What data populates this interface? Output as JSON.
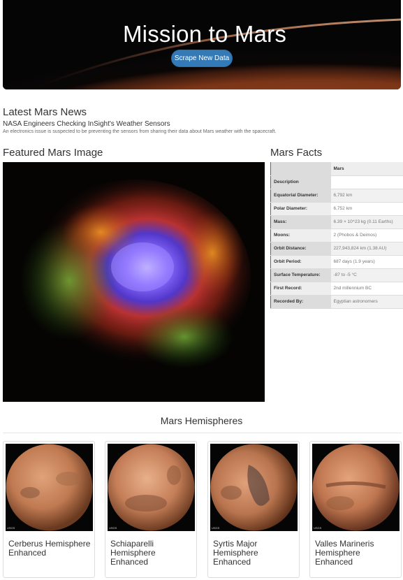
{
  "header": {
    "title": "Mission to Mars",
    "scrape_button": "Scrape New Data"
  },
  "news": {
    "heading": "Latest Mars News",
    "title": "NASA Engineers Checking InSight's Weather Sensors",
    "teaser": "An electronics issue is suspected to be preventing the sensors from sharing their data about Mars weather with the spacecraft."
  },
  "featured": {
    "heading": "Featured Mars Image"
  },
  "facts": {
    "heading": "Mars Facts",
    "column_header": "Mars",
    "index_header": "Description",
    "rows": [
      {
        "label": "Equatorial Diameter:",
        "value": "6,792 km"
      },
      {
        "label": "Polar Diameter:",
        "value": "6,752 km"
      },
      {
        "label": "Mass:",
        "value": "6.39 × 10^23 kg (0.11 Earths)"
      },
      {
        "label": "Moons:",
        "value": "2 (Phobos & Deimos)"
      },
      {
        "label": "Orbit Distance:",
        "value": "227,943,824 km (1.38 AU)"
      },
      {
        "label": "Orbit Period:",
        "value": "687 days (1.9 years)"
      },
      {
        "label": "Surface Temperature:",
        "value": "-87 to -5 °C"
      },
      {
        "label": "First Record:",
        "value": "2nd millennium BC"
      },
      {
        "label": "Recorded By:",
        "value": "Egyptian astronomers"
      }
    ]
  },
  "hemispheres": {
    "heading": "Mars Hemispheres",
    "items": [
      {
        "title": "Cerberus Hemisphere Enhanced",
        "logo": "USGS"
      },
      {
        "title": "Schiaparelli Hemisphere Enhanced",
        "logo": "USGS"
      },
      {
        "title": "Syrtis Major Hemisphere Enhanced",
        "logo": "USGS"
      },
      {
        "title": "Valles Marineris Hemisphere Enhanced",
        "logo": "USGS"
      }
    ]
  },
  "colors": {
    "button": "#337ab7",
    "text": "#333333",
    "mars": "#c0714a"
  }
}
